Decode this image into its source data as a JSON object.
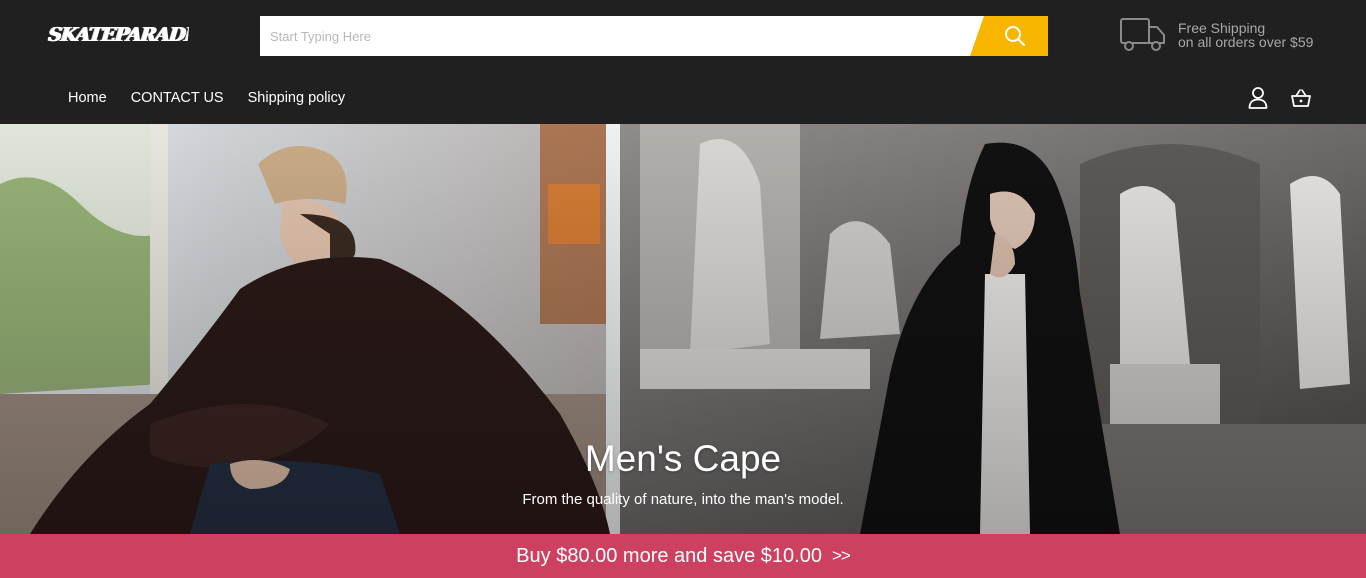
{
  "header": {
    "logo_text": "SKATEPARADISE",
    "search": {
      "placeholder": "Start Typing Here",
      "value": "",
      "button_icon": "search-icon"
    },
    "shipping": {
      "icon": "truck-icon",
      "line1": "Free Shipping",
      "line2": "on all orders over $59"
    },
    "nav": [
      {
        "label": "Home"
      },
      {
        "label": "CONTACT US"
      },
      {
        "label": "Shipping policy"
      }
    ],
    "account_icon": "user-icon",
    "cart_icon": "basket-icon"
  },
  "hero": {
    "title": "Men's Cape",
    "subtitle": "From the quality of nature, into the man's model."
  },
  "promo": {
    "text": "Buy $80.00 more and save $10.00",
    "arrows": ">>"
  },
  "colors": {
    "header_bg": "#202020",
    "search_button": "#f7b500",
    "promo_bg": "#cd4060",
    "shipping_text": "#a8a8a8"
  }
}
